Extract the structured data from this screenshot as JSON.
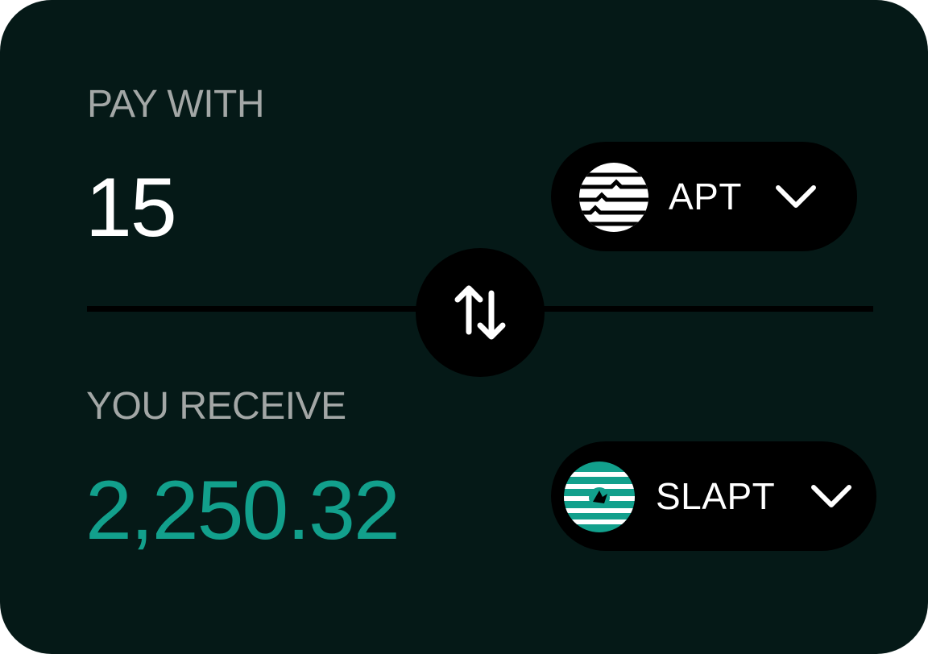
{
  "pay": {
    "label": "PAY WITH",
    "amount": "15",
    "token": "APT",
    "token_icon": "aptos-logo-icon"
  },
  "receive": {
    "label": "YOU RECEIVE",
    "amount": "2,250.32",
    "token": "SLAPT",
    "token_icon": "slapt-logo-icon"
  },
  "swap_icon": "swap-arrows-icon",
  "colors": {
    "background": "#051917",
    "label": "#a3a7a6",
    "accent": "#12a08c",
    "button": "#000000",
    "text": "#ffffff"
  }
}
